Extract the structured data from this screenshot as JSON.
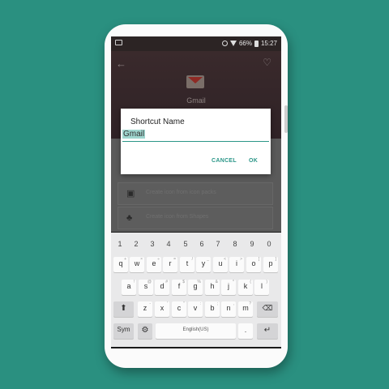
{
  "status_bar": {
    "battery": "66%",
    "time": "15:27"
  },
  "app": {
    "title": "Gmail"
  },
  "options": [
    {
      "icon": "widgets-icon",
      "glyph": "▣",
      "label": "Create icon from icon packs"
    },
    {
      "icon": "shapes-icon",
      "glyph": "♣",
      "label": "Create icon from Shapes"
    }
  ],
  "dialog": {
    "title": "Shortcut Name",
    "input_value": "Gmail",
    "cancel_label": "CANCEL",
    "ok_label": "OK"
  },
  "keyboard": {
    "numbers": [
      "1",
      "2",
      "3",
      "4",
      "5",
      "6",
      "7",
      "8",
      "9",
      "0"
    ],
    "row1": [
      "q",
      "w",
      "e",
      "r",
      "t",
      "y",
      "u",
      "i",
      "o",
      "p"
    ],
    "row1_sub": [
      "+",
      "×",
      "÷",
      "=",
      "/",
      "_",
      "<",
      ">",
      "[",
      "]"
    ],
    "row2": [
      "a",
      "s",
      "d",
      "f",
      "g",
      "h",
      "j",
      "k",
      "l"
    ],
    "row2_sub": [
      "!",
      "@",
      "#",
      "$",
      "%",
      "&",
      "*",
      "(",
      ")"
    ],
    "row3": [
      "z",
      "x",
      "c",
      "v",
      "b",
      "n",
      "m"
    ],
    "row3_sub": [
      "-",
      "'",
      "\"",
      ":",
      ";",
      ",",
      "?"
    ],
    "sym_label": "Sym",
    "space_label": "English(US)",
    "period_label": "."
  }
}
